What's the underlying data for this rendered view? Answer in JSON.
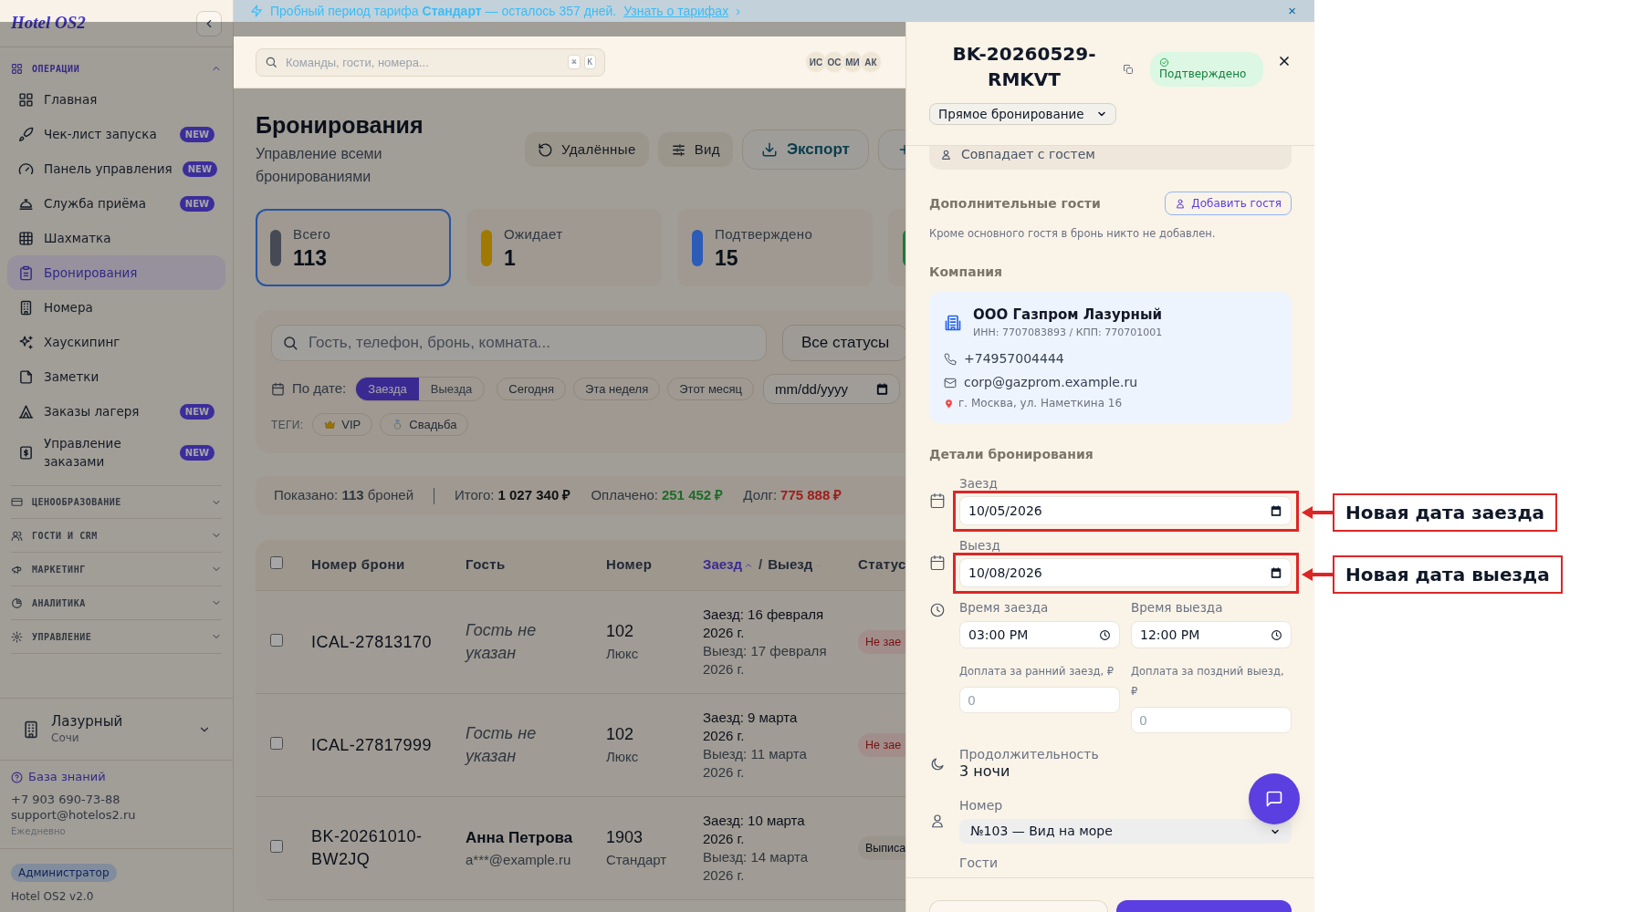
{
  "banner": {
    "text": "Пробный период тарифа **Стандарт** — осталось 357 дней.",
    "link": "Узнать о тарифах",
    "link_arrow": "›",
    "close": "×"
  },
  "sidebar": {
    "logo": "Hotel OS2",
    "sections": [
      {
        "title": "ОПЕРАЦИИ",
        "expanded": true,
        "items": [
          {
            "label": "Главная",
            "selected": false
          },
          {
            "label": "Чек-лист запуска",
            "badge": "NEW",
            "selected": false
          },
          {
            "label": "Панель управления",
            "badge": "NEW",
            "selected": false
          },
          {
            "label": "Служба приёма",
            "badge": "NEW",
            "selected": false
          },
          {
            "label": "Шахматка",
            "selected": false
          },
          {
            "label": "Бронирования",
            "selected": true
          },
          {
            "label": "Номера",
            "selected": false
          },
          {
            "label": "Хаускипинг",
            "selected": false
          },
          {
            "label": "Заметки",
            "selected": false
          },
          {
            "label": "Заказы лагеря",
            "badge": "NEW",
            "selected": false
          },
          {
            "label": "Управление заказами",
            "badge": "NEW",
            "selected": false
          }
        ]
      },
      {
        "title": "ЦЕНООБРАЗОВАНИЕ",
        "expanded": false
      },
      {
        "title": "ГОСТИ И CRM",
        "expanded": false
      },
      {
        "title": "МАРКЕТИНГ",
        "expanded": false
      },
      {
        "title": "АНАЛИТИКА",
        "expanded": false
      },
      {
        "title": "УПРАВЛЕНИЕ",
        "expanded": false
      }
    ],
    "property": {
      "name": "Лазурный",
      "city": "Сочи",
      "expanded": false
    },
    "support": {
      "link": "База знаний",
      "phone": "+7 903 690-73-88",
      "email": "support@hotelos2.ru",
      "hours": "Ежедневно"
    },
    "role": "Администратор",
    "version": "Hotel OS2 v2.0"
  },
  "header": {
    "search_placeholder": "Команды, гости, номера...",
    "keys": [
      "⌘",
      "K"
    ],
    "avatars": [
      "ИС",
      "ОС",
      "МИ",
      "АК"
    ]
  },
  "page": {
    "title": "Бронирования",
    "subtitle": "Управление всеми бронированиями",
    "actions": [
      {
        "label": "Удалённые",
        "kind": "restore"
      },
      {
        "label": "Вид",
        "kind": "view"
      },
      {
        "label": "Экспорт",
        "kind": "export"
      }
    ]
  },
  "stats": [
    {
      "label": "Всего",
      "value": "113",
      "color": "#454a55",
      "selected": true
    },
    {
      "label": "Ожидает",
      "value": "1",
      "color": "#a07a00",
      "selected": false
    },
    {
      "label": "Подтверждено",
      "value": "15",
      "color": "#2d5bb8",
      "selected": false
    },
    {
      "color": "#1f7a3a",
      "selected": false
    }
  ],
  "filters": {
    "search_placeholder": "Гость, телефон, бронь, комната...",
    "status": "Все статусы",
    "date_label": "По дате:",
    "modes": [
      {
        "label": "Заезда",
        "selected": true
      },
      {
        "label": "Выезда",
        "selected": false
      }
    ],
    "quick": [
      "Сегодня",
      "Эта неделя",
      "Этот месяц"
    ],
    "date_placeholder": "mm/dd/yyyy",
    "tags_label": "ТЕГИ:",
    "tags": [
      "VIP",
      "Свадьба"
    ]
  },
  "summary": {
    "shown": "Показано: **113** броней",
    "items": [
      {
        "label": "Итого:",
        "value": "1 027 340 ₽",
        "color": "#111111"
      },
      {
        "label": "Оплачено:",
        "value": "251 452 ₽",
        "color": "#1f6b2a"
      },
      {
        "label": "Долг:",
        "value": "775 888 ₽",
        "color": "#a01c1c"
      }
    ]
  },
  "table": {
    "select_all": false,
    "columns": [
      "Номер брони",
      "Гость",
      "Номер"
    ],
    "date_columns": [
      {
        "label": "Заезд",
        "sorted": true
      },
      {
        "label": "Выезд",
        "sorted": false
      }
    ],
    "date_separator": "/",
    "status_column": "Статус",
    "rows": [
      {
        "checked": false,
        "id": "ICAL-27813170",
        "guest": "Гость не указан",
        "guest_known": false,
        "room": "102",
        "room_type": "Люкс",
        "checkin": "Заезд: 16 февраля 2026 г.",
        "checkout": "Выезд: 17 февраля 2026 г.",
        "status": "Не зае",
        "kind": "danger"
      },
      {
        "checked": false,
        "id": "ICAL-27817999",
        "guest": "Гость не указан",
        "guest_known": false,
        "room": "102",
        "room_type": "Люкс",
        "checkin": "Заезд: 9 марта 2026 г.",
        "checkout": "Выезд: 11 марта 2026 г.",
        "status": "Не зае",
        "kind": "danger"
      },
      {
        "checked": false,
        "id": "BK-20261010-BW2JQ",
        "guest": "Анна Петрова",
        "guest_known": true,
        "email": "a***@example.ru",
        "room": "1903",
        "room_type": "Стандарт",
        "checkin": "Заезд: 10 марта 2026 г.",
        "checkout": "Выезд: 14 марта 2026 г.",
        "status": "Выписа",
        "kind": "neutral"
      }
    ]
  },
  "drawer": {
    "title": "BK-20260529-RMKVT",
    "status": "Подтверждено",
    "source": "Прямое бронирование",
    "guest_match": "Совпадает с гостем",
    "extra_title": "Дополнительные гости",
    "add_guest": "Добавить гостя",
    "extra_note": "Кроме основного гостя в бронь никто не добавлен.",
    "company_title": "Компания",
    "company": {
      "name": "ООО Газпром Лазурный",
      "ids": "ИНН: 7707083893 / КПП: 770701001",
      "phone": "+74957004444",
      "email": "corp@gazprom.example.ru",
      "address": "г. Москва, ул. Наметкина 16"
    },
    "details_title": "Детали бронирования",
    "checkin": {
      "label": "Заезд",
      "value": "10/05/2026",
      "highlighted": true
    },
    "checkout": {
      "label": "Выезд",
      "value": "10/08/2026",
      "highlighted": true
    },
    "time_in": {
      "label": "Время заезда",
      "value": "03:00 PM"
    },
    "time_out": {
      "label": "Время выезда",
      "value": "12:00 PM"
    },
    "fee_early": {
      "label": "Доплата за ранний заезд, ₽",
      "placeholder": "0"
    },
    "fee_late": {
      "label": "Доплата за поздний выезд, ₽",
      "placeholder": "0"
    },
    "duration": {
      "label": "Продолжительность",
      "value": "3 ночи"
    },
    "room": {
      "label": "Номер",
      "value": "№103 — Вид на море"
    },
    "guests_label": "Гости"
  },
  "annotations": [
    {
      "text": "Новая дата заезда"
    },
    {
      "text": "Новая дата выезда"
    }
  ]
}
